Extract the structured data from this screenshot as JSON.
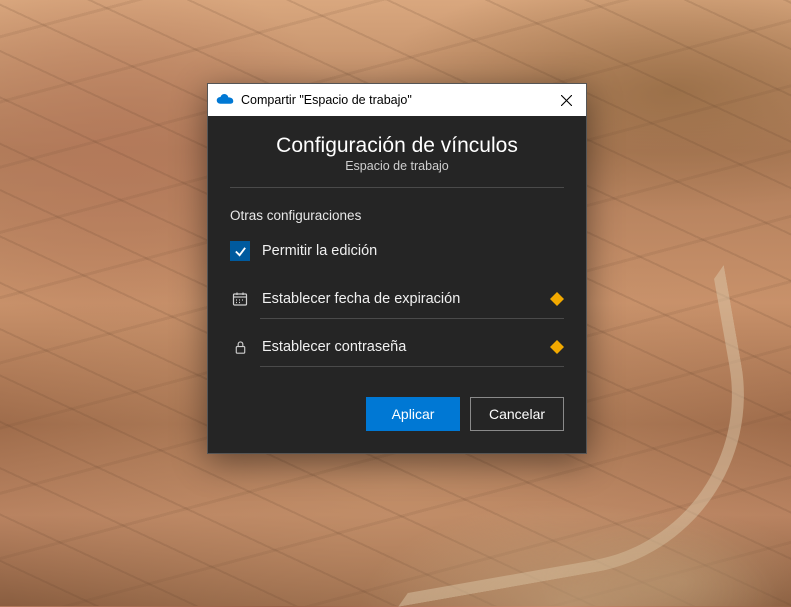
{
  "titlebar": {
    "title": "Compartir \"Espacio de trabajo\""
  },
  "header": {
    "title": "Configuración de vínculos",
    "subtitle": "Espacio de trabajo"
  },
  "settings": {
    "section_label": "Otras configuraciones",
    "allow_editing_label": "Permitir la edición",
    "allow_editing_checked": true,
    "expiration_label": "Establecer fecha de expiración",
    "password_label": "Establecer contraseña"
  },
  "buttons": {
    "apply": "Aplicar",
    "cancel": "Cancelar"
  },
  "icons": {
    "app": "onedrive-cloud",
    "calendar": "calendar",
    "lock": "lock",
    "premium": "diamond"
  }
}
